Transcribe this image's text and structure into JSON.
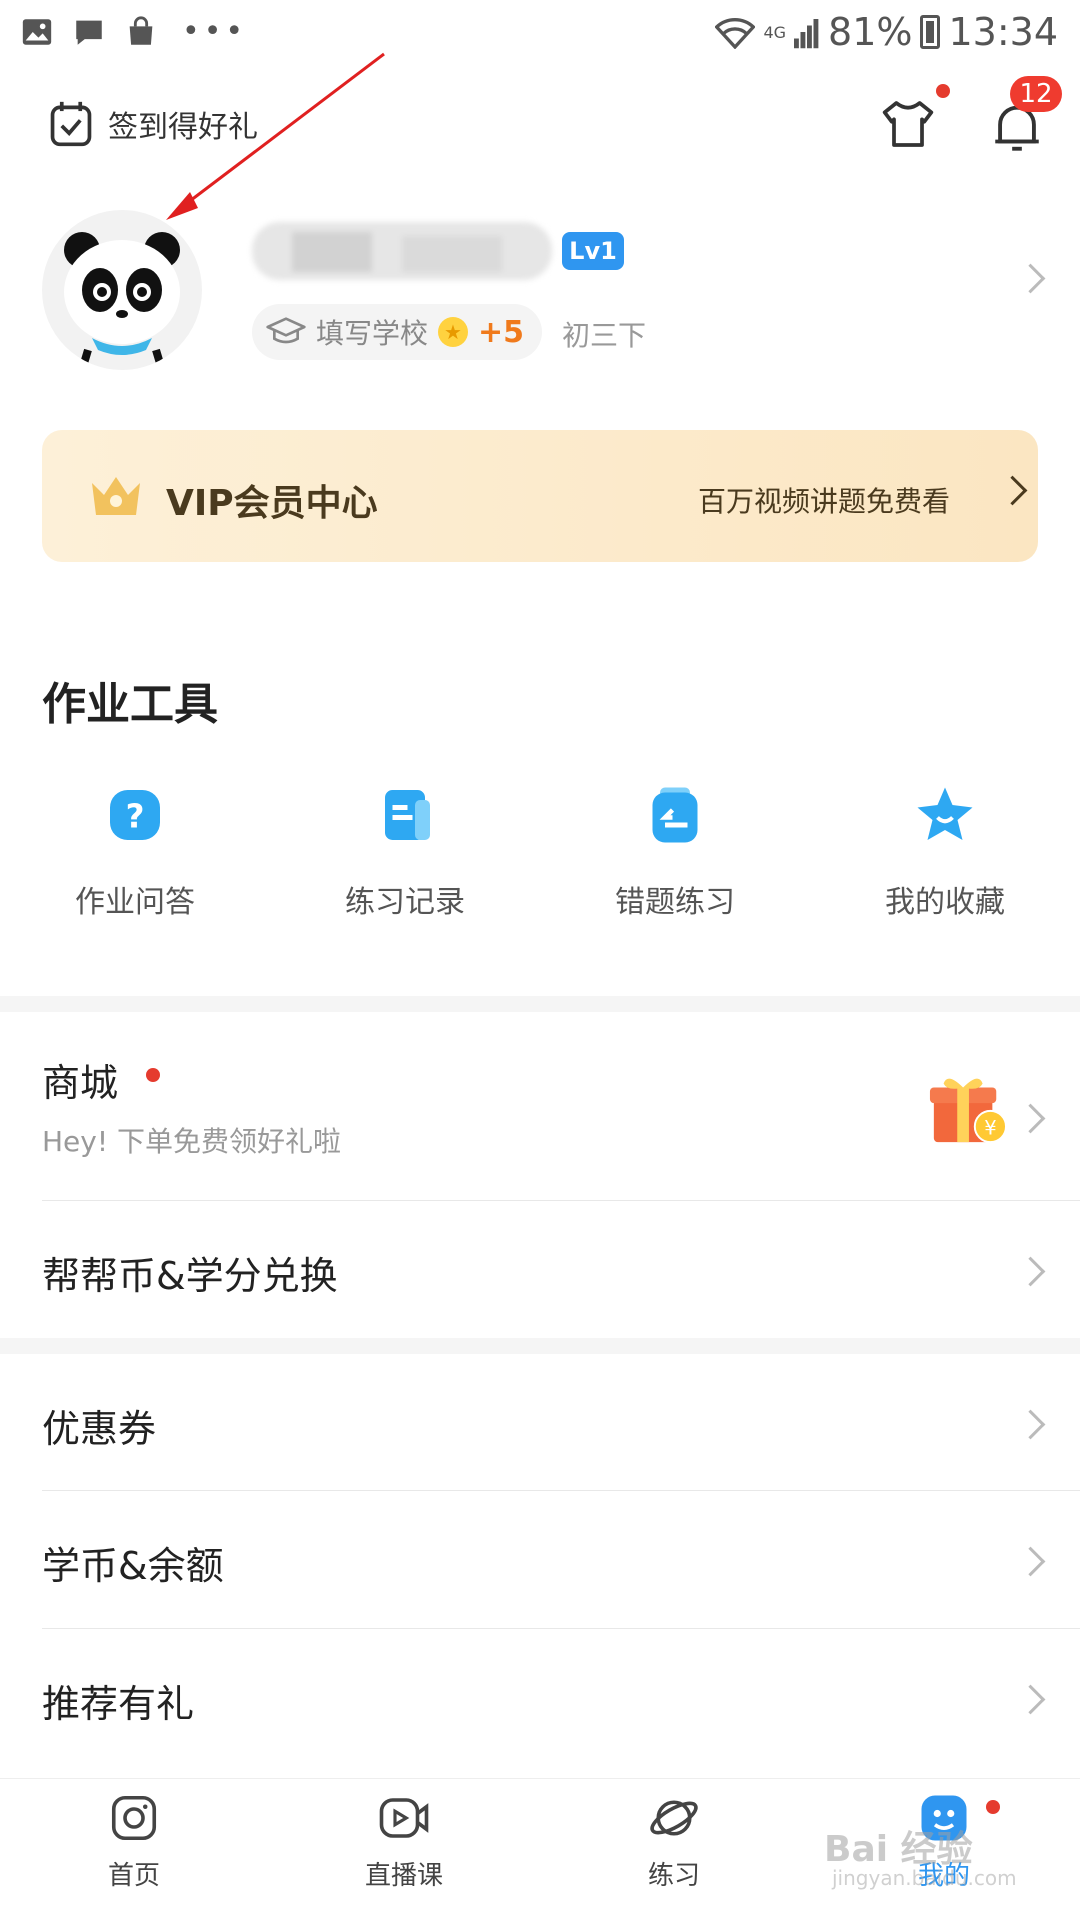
{
  "status_bar": {
    "battery": "81%",
    "time": "13:34",
    "network": "4G",
    "icons": [
      "gallery-icon",
      "message-icon",
      "bag-icon",
      "more-dots-icon",
      "wifi-icon",
      "signal-icon",
      "battery-icon"
    ]
  },
  "header": {
    "checkin_label": "签到得好礼",
    "notification_count": "12"
  },
  "profile": {
    "level": "Lv1",
    "school_label": "填写学校",
    "school_bonus": "+5",
    "grade": "初三下"
  },
  "vip": {
    "title": "VIP会员中心",
    "description": "百万视频讲题免费看"
  },
  "tools": {
    "title": "作业工具",
    "items": [
      {
        "label": "作业问答",
        "icon": "question-icon"
      },
      {
        "label": "练习记录",
        "icon": "document-icon"
      },
      {
        "label": "错题练习",
        "icon": "wrong-answer-icon"
      },
      {
        "label": "我的收藏",
        "icon": "star-icon"
      }
    ]
  },
  "menu": {
    "mall": {
      "title": "商城",
      "subtitle": "Hey! 下单免费领好礼啦"
    },
    "exchange": {
      "title": "帮帮币&学分兑换"
    },
    "coupons": {
      "title": "优惠券"
    },
    "balance": {
      "title": "学币&余额"
    },
    "referral": {
      "title": "推荐有礼"
    }
  },
  "bottom_nav": {
    "items": [
      {
        "label": "首页",
        "icon": "camera-icon"
      },
      {
        "label": "直播课",
        "icon": "video-icon"
      },
      {
        "label": "练习",
        "icon": "planet-icon"
      },
      {
        "label": "我的",
        "icon": "profile-icon",
        "active": true
      }
    ]
  },
  "watermark": {
    "text": "Bai 经验",
    "sub": "jingyan.baidu.com"
  },
  "colors": {
    "accent": "#2f96f0",
    "badge_red": "#ef3b2f",
    "vip_bg": "#fbe6c2",
    "bonus_orange": "#f07a1c"
  }
}
